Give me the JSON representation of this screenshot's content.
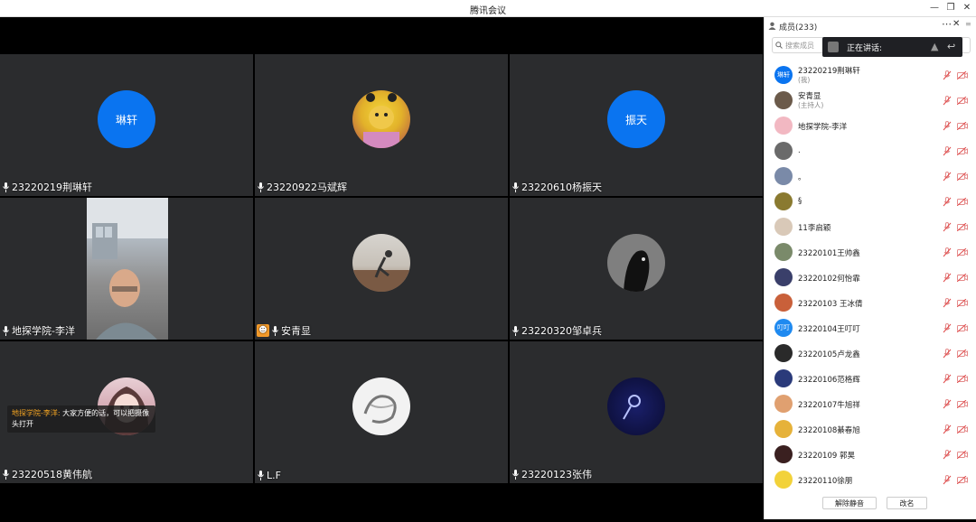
{
  "window": {
    "title": "腾讯会议"
  },
  "tiles": [
    {
      "name": "23220219荆琳轩",
      "avatar_text": "琳轩"
    },
    {
      "name": "23220922马斌辉"
    },
    {
      "name": "23220610杨振天",
      "avatar_text": "振天"
    },
    {
      "name": "地探学院-李洋"
    },
    {
      "name": "安青显"
    },
    {
      "name": "23220320邹卓兵"
    },
    {
      "name": "23220518黄伟航"
    },
    {
      "name": "L.F"
    },
    {
      "name": "23220123张伟"
    }
  ],
  "chat": {
    "sender": "地探学院-李洋:",
    "message": "大家方便的话，可以把摄像头打开"
  },
  "panel": {
    "title": "成员(233)",
    "search_placeholder": "搜索成员",
    "speaking_label": "正在讲话:",
    "members": [
      {
        "name": "23220219荆琳轩",
        "role": "(我)",
        "avatar_text": "琳轩",
        "color": "#0a74f0"
      },
      {
        "name": "安青显",
        "role": "(主持人)",
        "color": "#6b5a4a"
      },
      {
        "name": "地探学院-李洋",
        "color": "#f2b8c2"
      },
      {
        "name": ".",
        "color": "#6a6a6a"
      },
      {
        "name": "。",
        "color": "#7a8aa8"
      },
      {
        "name": "§",
        "color": "#8a7a30"
      },
      {
        "name": "11李启颖",
        "color": "#d9c9b8"
      },
      {
        "name": "23220101王帅鑫",
        "color": "#7a8a6a"
      },
      {
        "name": "23220102何怡霏",
        "color": "#3a3f6a"
      },
      {
        "name": "23220103   王冰倩",
        "color": "#c9603a"
      },
      {
        "name": "23220104王叮叮",
        "avatar_text": "叮叮",
        "color": "#1f8af0"
      },
      {
        "name": "23220105卢龙鑫",
        "color": "#2a2a2a"
      },
      {
        "name": "23220106范格辉",
        "color": "#2a3a7a"
      },
      {
        "name": "23220107牛旭祥",
        "color": "#e0a070"
      },
      {
        "name": "23220108綦春旭",
        "color": "#e6b23a"
      },
      {
        "name": "23220109  郭昊",
        "color": "#3a2020"
      },
      {
        "name": "23220110徐朋",
        "color": "#f2d23a"
      }
    ],
    "unmute_all": "解除静音",
    "rename": "改名"
  }
}
